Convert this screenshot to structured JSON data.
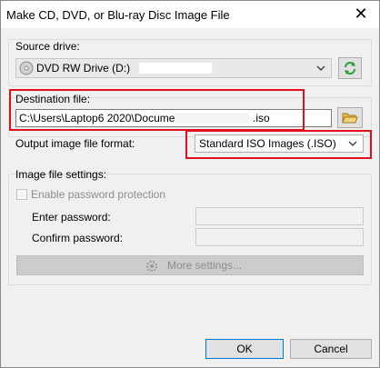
{
  "window": {
    "title": "Make CD, DVD, or Blu-ray Disc Image File",
    "close_label": "✕"
  },
  "source": {
    "group_label": "Source drive:",
    "drive_value": "DVD RW Drive (D:)",
    "refresh_icon": "refresh-icon"
  },
  "destination": {
    "label": "Destination file:",
    "path_value": "C:\\Users\\Laptop6 2020\\Documents\\",
    "path_suffix": ".iso",
    "browse_icon": "folder-open-icon"
  },
  "format": {
    "label": "Output image file format:",
    "selected": "Standard ISO Images (.ISO)"
  },
  "settings": {
    "group_label": "Image file settings:",
    "enable_password_label": "Enable password protection",
    "enter_password_label": "Enter password:",
    "confirm_password_label": "Confirm password:",
    "more_settings_label": "More settings..."
  },
  "buttons": {
    "ok": "OK",
    "cancel": "Cancel"
  },
  "colors": {
    "highlight": "#e01020",
    "refresh_green": "#2e9b3a",
    "folder_yellow": "#e8b84a"
  }
}
